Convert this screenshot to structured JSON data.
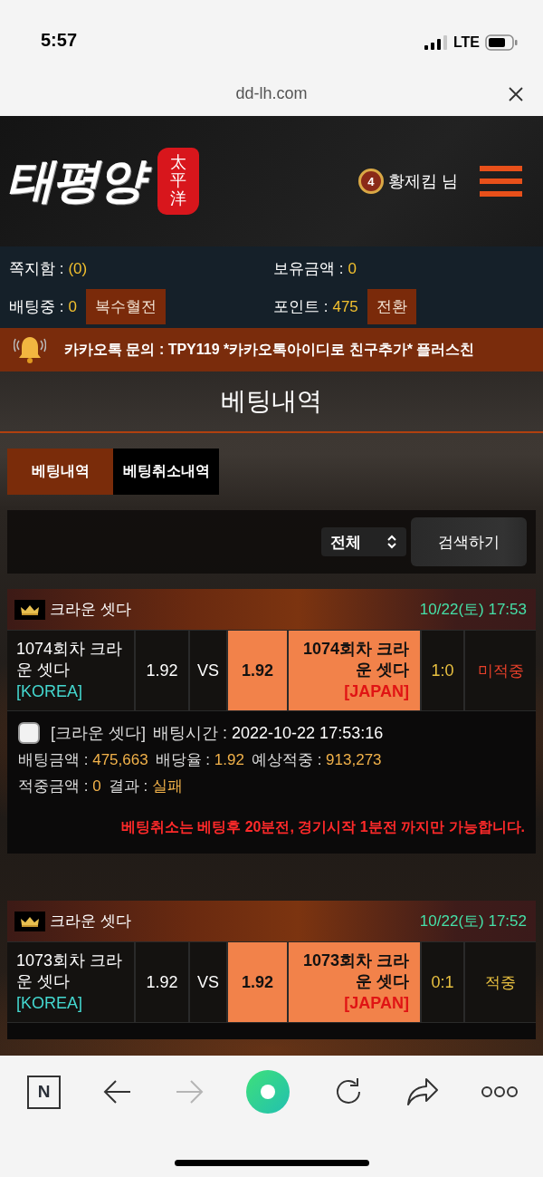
{
  "status_bar": {
    "time": "5:57",
    "network": "LTE"
  },
  "browser": {
    "url": "dd-lh.com"
  },
  "header": {
    "logo": "태평양",
    "seal": "太平洋",
    "level": "4",
    "user": "황제킴 님"
  },
  "account": [
    {
      "label": "쪽지함 :",
      "value": "(0)"
    },
    {
      "label": "보유금액 :",
      "value": "0"
    },
    {
      "label": "배팅중 :",
      "value": "0",
      "button": "복수혈전"
    },
    {
      "label": "포인트 :",
      "value": "475",
      "button": "전환"
    }
  ],
  "notice": {
    "text": "카카오톡 문의 : TPY119 *카카오톡아이디로 친구추가* 플러스친"
  },
  "page_title": "베팅내역",
  "tabs": [
    {
      "label": "베팅내역",
      "selected": true
    },
    {
      "label": "베팅취소내역",
      "selected": false
    }
  ],
  "filter": {
    "value": "전체",
    "button": "검색하기"
  },
  "bets": [
    {
      "game": "크라운 셋다",
      "date": "10/22(토) 17:53",
      "home": {
        "name": "1074회차 크라운 셋다",
        "tag": "[KOREA]",
        "odds": "1.92",
        "selected": false
      },
      "vs": "VS",
      "away": {
        "name": "1074회차 크라운 셋다",
        "tag": "[JAPAN]",
        "odds": "1.92",
        "selected": true
      },
      "score": "1:0",
      "result": {
        "text": "미적중",
        "kind": "miss"
      },
      "details": {
        "checked": false,
        "game": "[크라운 셋다]",
        "lines": [
          [
            {
              "label": "배팅시간 :",
              "value": "2022-10-22 17:53:16",
              "highlight": false
            }
          ],
          [
            {
              "label": "배팅금액 :",
              "value": "475,663",
              "highlight": true
            },
            {
              "label": "배당율 :",
              "value": "1.92",
              "highlight": true
            },
            {
              "label": "예상적중 :",
              "value": "913,273",
              "highlight": true
            }
          ],
          [
            {
              "label": "적중금액 :",
              "value": "0",
              "highlight": true
            },
            {
              "label": "결과 :",
              "value": "실패",
              "highlight": true
            }
          ]
        ],
        "warning": "베팅취소는 베팅후 20분전, 경기시작 1분전 까지만 가능합니다."
      }
    },
    {
      "game": "크라운 셋다",
      "date": "10/22(토) 17:52",
      "home": {
        "name": "1073회차 크라운 셋다",
        "tag": "[KOREA]",
        "odds": "1.92",
        "selected": false
      },
      "vs": "VS",
      "away": {
        "name": "1073회차 크라운 셋다",
        "tag": "[JAPAN]",
        "odds": "1.92",
        "selected": true
      },
      "score": "0:1",
      "result": {
        "text": "적중",
        "kind": "hit"
      }
    }
  ],
  "toolbar": {
    "buttons": [
      {
        "kind": "letter",
        "label": "N",
        "disabled": false
      },
      {
        "kind": "back",
        "disabled": false
      },
      {
        "kind": "forward",
        "disabled": true
      },
      {
        "kind": "ring",
        "disabled": false
      },
      {
        "kind": "reload",
        "disabled": false
      },
      {
        "kind": "share",
        "disabled": false
      },
      {
        "kind": "more",
        "disabled": false
      }
    ]
  }
}
